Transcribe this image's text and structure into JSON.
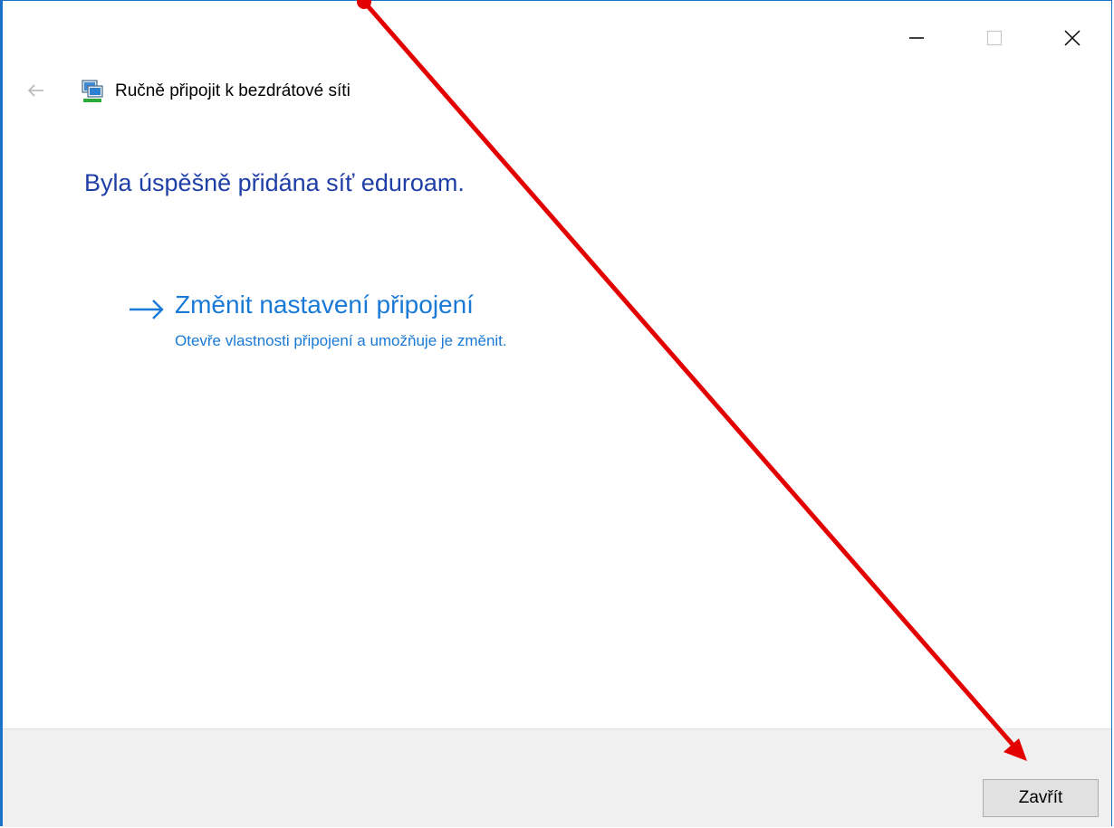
{
  "window": {
    "controls": {
      "minimize_icon": "minimize-icon",
      "maximize_icon": "maximize-icon",
      "close_icon": "close-icon"
    }
  },
  "nav": {
    "back_icon": "back-arrow-icon",
    "app_icon": "network-icon",
    "title": "Ručně připojit k bezdrátové síti"
  },
  "main": {
    "heading": "Byla úspěšně přidána síť eduroam.",
    "command_link": {
      "icon": "right-arrow-icon",
      "title": "Změnit nastavení připojení",
      "description": "Otevře vlastnosti připojení a umožňuje je změnit."
    }
  },
  "footer": {
    "close_label": "Zavřít"
  },
  "colors": {
    "heading": "#1e3fa6",
    "link": "#1979d6",
    "footer_bg": "#f0f0f0",
    "annotation_arrow": "#e30000"
  }
}
